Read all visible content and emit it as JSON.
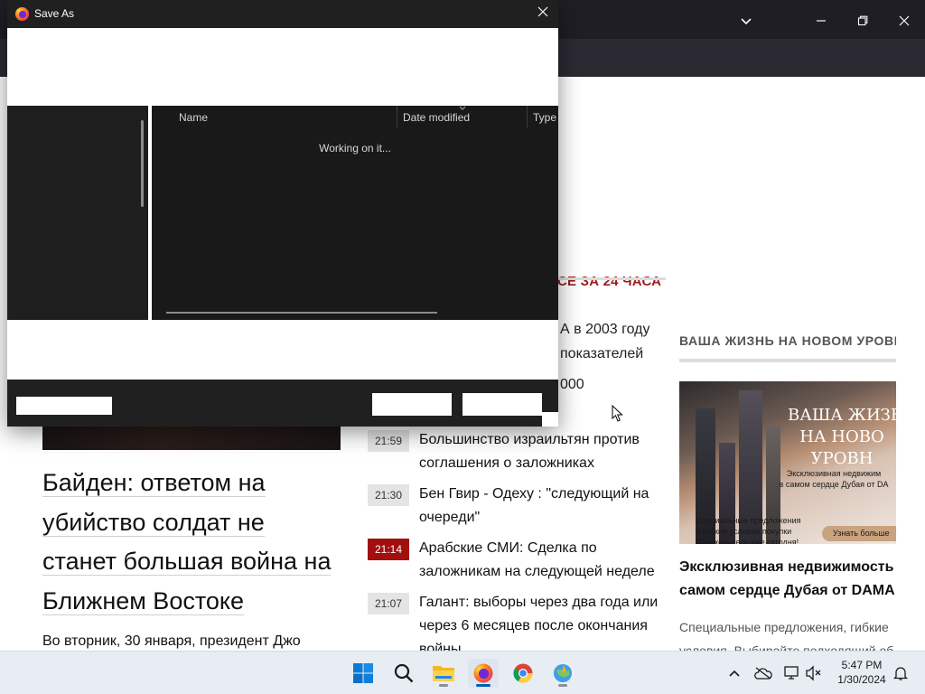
{
  "dialog": {
    "title": "Save As",
    "columns": {
      "name": "Name",
      "date_modified": "Date modified",
      "type": "Type"
    },
    "status": "Working on it...",
    "save_button": "",
    "cancel_button": "",
    "hide_folders_button": ""
  },
  "webpage": {
    "section_heading": "СЕ ЗА 24 ЧАСА",
    "partial_lines": [
      "А в 2003 году",
      "показателей",
      "000"
    ],
    "news": [
      {
        "time": "21:59",
        "text": "Большинство израильтян против соглашения о заложниках",
        "hot": false
      },
      {
        "time": "21:30",
        "text": "Бен Гвир  - Одеху : \"следующий на очереди\"",
        "hot": false
      },
      {
        "time": "21:14",
        "text": "Арабские СМИ: Сделка по заложникам на следующей неделе",
        "hot": true
      },
      {
        "time": "21:07",
        "text": "Галант: выборы через два года или через 6 месяцев после окончания войны",
        "hot": false
      }
    ],
    "headline_lines": [
      "Байден: ответом на",
      "убийство солдат не",
      "станет большая война на",
      "Ближнем Востоке"
    ],
    "lead": "Во вторник, 30 января,  президент Джо",
    "aside": {
      "heading": "ВАША ЖИЗНЬ НА НОВОМ УРОВНЕ",
      "ad_title_lines": [
        "ВАША ЖИЗН",
        "НА НОВО",
        "УРОВН"
      ],
      "ad_sub_lines": [
        "Эксклюзивная недвижим",
        "в самом сердце Дубая от DA"
      ],
      "ad_small_lines": [
        "Специальные предложения",
        "и гибкие условия покупки",
        "Ознакомьтесь уже сегодня!"
      ],
      "ad_cta": "Узнать больше",
      "title_lines": [
        "Эксклюзивная недвижимость",
        "самом сердце Дубая от DAMA"
      ],
      "desc_lines": [
        "Специальные предложения, гибкие",
        "условия. Выбирайте подходящий об"
      ]
    }
  },
  "taskbar": {
    "time": "5:47 PM",
    "date": "1/30/2024",
    "apps": [
      "start-icon",
      "search-icon",
      "file-explorer-icon",
      "firefox-icon",
      "chrome-icon",
      "browser-app-icon"
    ]
  },
  "colors": {
    "dialog_bg": "#202020",
    "browser_toolbar": "#2b2a33",
    "headline_red": "#9b1c1c",
    "hot_badge": "#a30e0e",
    "taskbar": "#e8edf4",
    "accent": "#005fb8"
  }
}
